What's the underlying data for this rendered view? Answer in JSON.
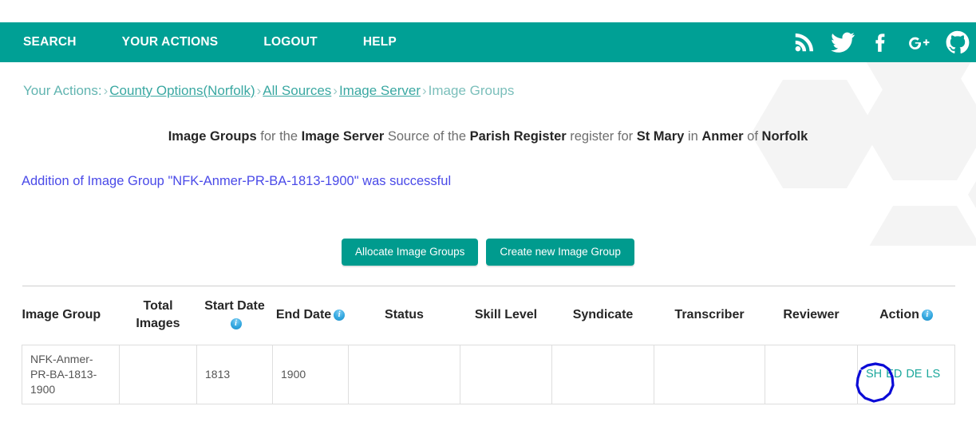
{
  "navbar": {
    "links": [
      {
        "label": "SEARCH",
        "name": "nav-link-search"
      },
      {
        "label": "YOUR ACTIONS",
        "name": "nav-link-your-actions"
      },
      {
        "label": "LOGOUT",
        "name": "nav-link-logout"
      },
      {
        "label": "HELP",
        "name": "nav-link-help"
      }
    ],
    "social": [
      {
        "icon": "rss-icon"
      },
      {
        "icon": "twitter-icon"
      },
      {
        "icon": "facebook-icon"
      },
      {
        "icon": "google-plus-icon"
      },
      {
        "icon": "github-icon"
      }
    ],
    "background_color": "#00a095"
  },
  "breadcrumb": {
    "root": "Your Actions:",
    "separator": "›",
    "items": [
      "County Options(Norfolk)",
      "All Sources",
      "Image Server",
      "Image Groups"
    ]
  },
  "headline": {
    "p1": "Image Groups",
    "p2": " for the ",
    "p3": "Image Server",
    "p4": " Source of the ",
    "p5": "Parish Register",
    "p6": " register for ",
    "p7": "St Mary",
    "p8": " in ",
    "p9": "Anmer",
    "p10": " of ",
    "p11": "Norfolk"
  },
  "flash": {
    "message": "Addition of Image Group \"NFK-Anmer-PR-BA-1813-1900\" was successful",
    "color": "#4a4ae8"
  },
  "buttons": {
    "allocate": "Allocate Image Groups",
    "create": "Create new Image Group",
    "color": "#009b8e"
  },
  "table": {
    "columns": [
      {
        "label": "Image Group",
        "info": false
      },
      {
        "label": "Total Images",
        "info": false
      },
      {
        "label": "Start Date",
        "info": true
      },
      {
        "label": "End Date",
        "info": true
      },
      {
        "label": "Status",
        "info": false
      },
      {
        "label": "Skill Level",
        "info": false
      },
      {
        "label": "Syndicate",
        "info": false
      },
      {
        "label": "Transcriber",
        "info": false
      },
      {
        "label": "Reviewer",
        "info": false
      },
      {
        "label": "Action",
        "info": true
      }
    ],
    "rows": [
      {
        "image_group": "NFK-Anmer-PR-BA-1813-1900",
        "total_images": "",
        "start_date": "1813",
        "end_date": "1900",
        "status": "",
        "skill_level": "",
        "syndicate": "",
        "transcriber": "",
        "reviewer": "",
        "actions": [
          "SH",
          "ED",
          "DE",
          "LS"
        ]
      }
    ],
    "link_color": "#1aa79b",
    "border_color": "#dedede"
  },
  "annotation": {
    "shape": "hand-drawn-circle",
    "color": "#0000dd",
    "target": "SH"
  }
}
